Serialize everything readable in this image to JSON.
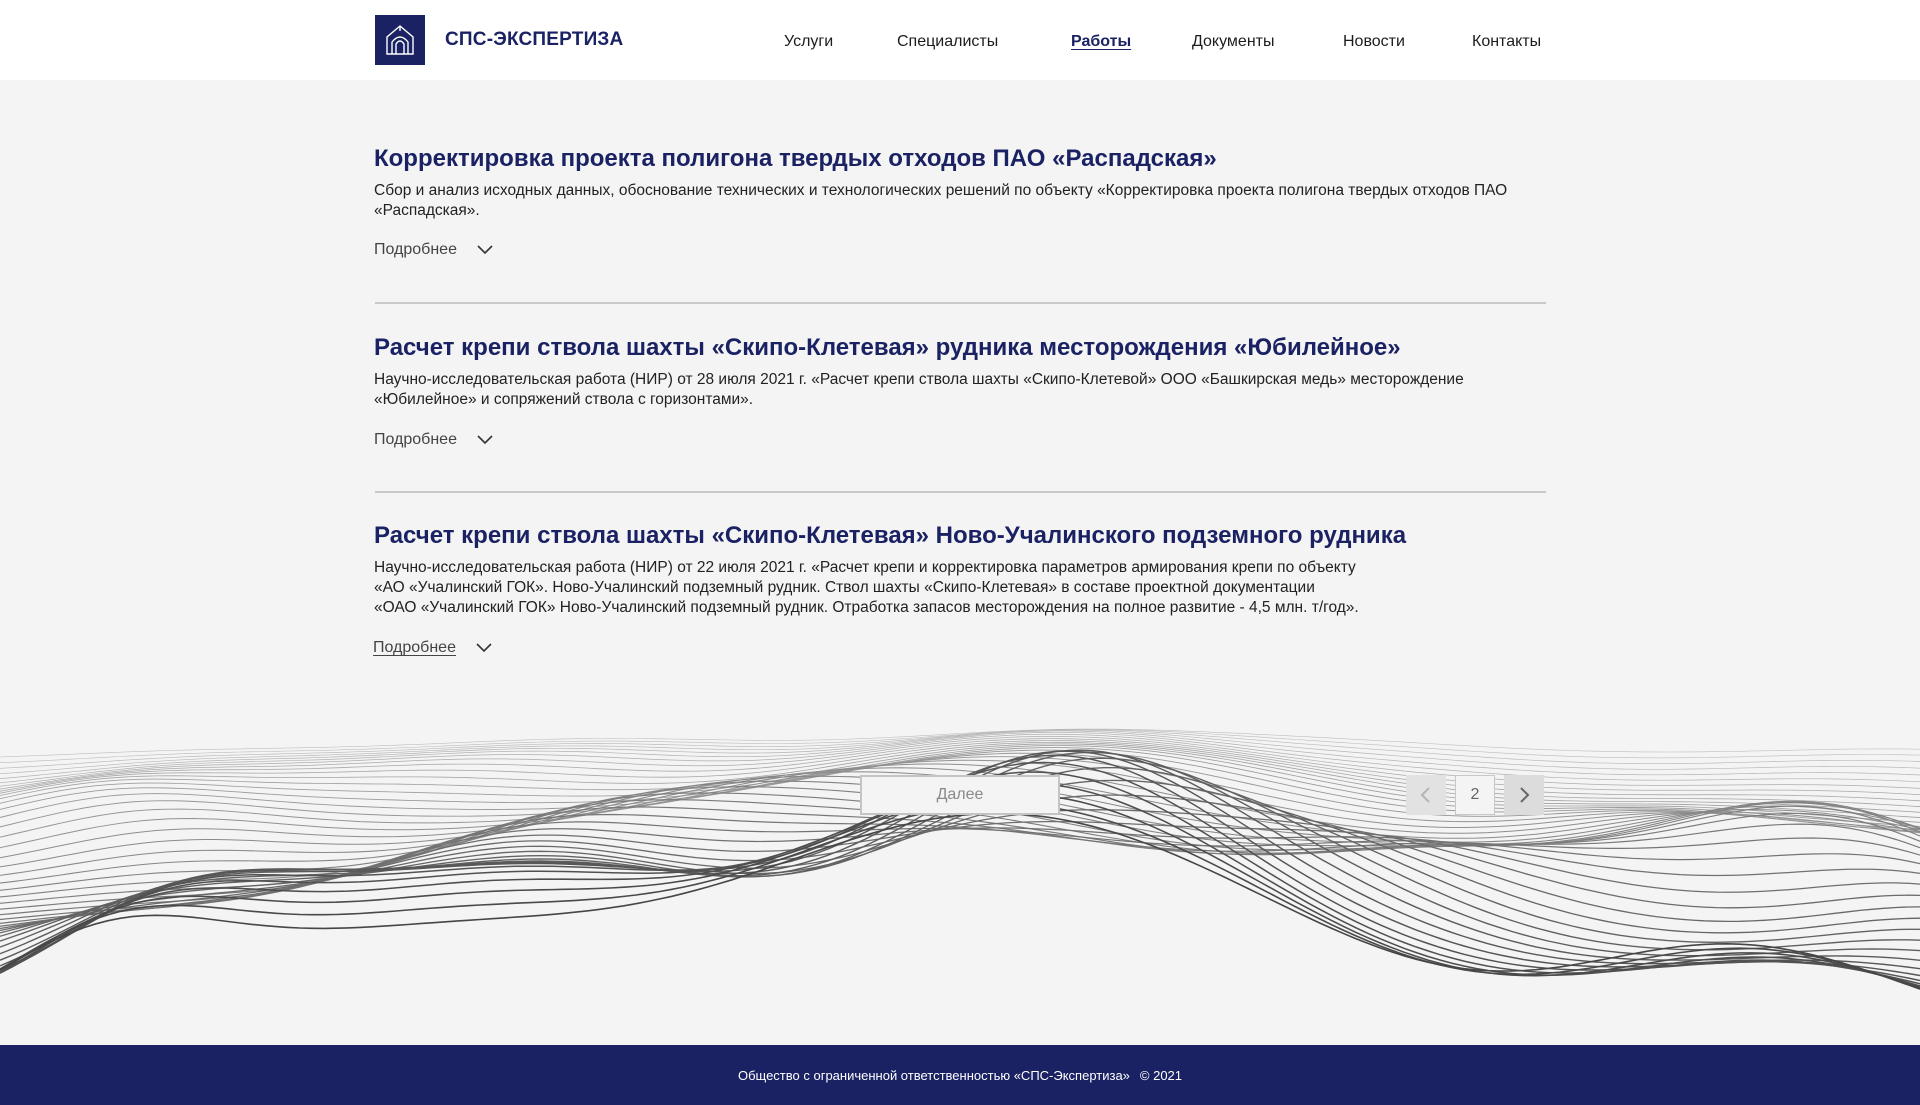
{
  "header": {
    "logo_text": "СПС-ЭКСПЕРТИЗА",
    "nav": [
      {
        "label": "Услуги"
      },
      {
        "label": "Специалисты"
      },
      {
        "label": "Работы"
      },
      {
        "label": "Документы"
      },
      {
        "label": "Новости"
      },
      {
        "label": "Контакты"
      }
    ],
    "active_nav": "Работы"
  },
  "articles": [
    {
      "title": "Корректировка проекта полигона твердых отходов ПАО «Распадская»",
      "description": "Сбор и анализ исходных данных, обоснование технических и технологических решений по объекту «Корректировка проекта полигона твердых отходов ПАО «Распадская».",
      "more_label": "Подробнее"
    },
    {
      "title": "Расчет крепи ствола шахты «Скипо-Клетевая» рудника месторождения «Юбилейное»",
      "description": "Научно-исследовательская работа (НИР) от 28 июля 2021 г. «Расчет крепи ствола шахты «Скипо-Клетевой» ООО «Башкирская медь» месторождение «Юбилейное» и сопряжений ствола с горизонтами».",
      "more_label": "Подробнее"
    },
    {
      "title": "Расчет крепи ствола шахты «Скипо-Клетевая» Ново-Учалинского подземного рудника",
      "description_lines": [
        "Научно-исследовательская работа (НИР) от 22 июля 2021 г. «Расчет крепи и корректировка параметров армирования крепи по объекту",
        "«АО «Учалинский ГОК». Ново-Учалинский подземный рудник. Ствол шахты «Скипо-Клетевая» в составе проектной документации",
        "«ОАО «Учалинский ГОК» Ново-Учалинский подземный рудник. Отработка запасов месторождения на полное развитие - 4,5 млн. т/год»."
      ],
      "more_label": "Подробнее"
    }
  ],
  "pagination": {
    "more_button": "Далее",
    "current_page": "2",
    "prev_enabled": false,
    "next_enabled": true
  },
  "footer": {
    "company": "Общество с ограниченной ответственностью «СПС-Экспертиза»",
    "copyright": "© 2021"
  },
  "colors": {
    "brand": "#1a2264",
    "background": "#f4f4f4"
  }
}
